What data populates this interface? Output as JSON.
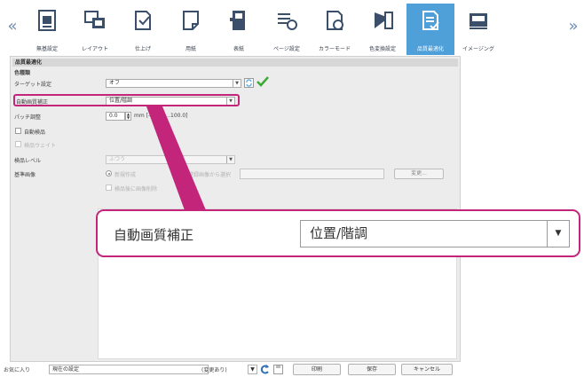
{
  "toolbar": {
    "tabs": [
      {
        "label": "無基設定",
        "icon": "page-setup-icon"
      },
      {
        "label": "レイアウト",
        "icon": "layout-icon"
      },
      {
        "label": "仕上げ",
        "icon": "finishing-icon"
      },
      {
        "label": "用紙",
        "icon": "paper-icon"
      },
      {
        "label": "表紙",
        "icon": "cover-icon"
      },
      {
        "label": "ページ設定",
        "icon": "page-settings-icon"
      },
      {
        "label": "カラーモード",
        "icon": "color-mode-icon"
      },
      {
        "label": "色変換設定",
        "icon": "color-conversion-icon"
      },
      {
        "label": "品質最適化",
        "icon": "quality-optimize-icon"
      },
      {
        "label": "イメージング",
        "icon": "imaging-icon"
      }
    ],
    "active_tab": "品質最適化",
    "scroll_left_glyph": "«",
    "scroll_right_glyph": "»"
  },
  "panel": {
    "section_title": "品質最適化",
    "color_group_label": "色種類",
    "target_label": "ターゲット設定",
    "target_value": "オフ",
    "auto_quality_label": "自動画質補正",
    "auto_quality_value": "位置/階調",
    "patch_label": "パッチ調整",
    "patch_value": "0.0",
    "patch_range": "mm [-100.0...100.0]",
    "auto_inspect_label": "自動検品",
    "inspect_weight_label": "検品ウェイト",
    "inspect_level_label": "検品レベル",
    "inspect_level_value": "ふつう",
    "reference_label": "基準画像",
    "radio_new_label": "新規作成",
    "radio_select_label": "登録画像から選択",
    "browse_button": "変更...",
    "save_checkbox_label": "検品後に画像削除"
  },
  "callout": {
    "label": "自動画質補正",
    "value": "位置/階調"
  },
  "footer": {
    "favorites_label": "お気に入り",
    "favorites_value": "現在の設定",
    "changed_text": "(変更あり)",
    "print_button": "印刷",
    "save_button": "保存",
    "cancel_button": "キャンセル"
  },
  "colors": {
    "accent": "#4f9fd8",
    "highlight": "#c2257a",
    "check_green": "#3aaa35"
  }
}
